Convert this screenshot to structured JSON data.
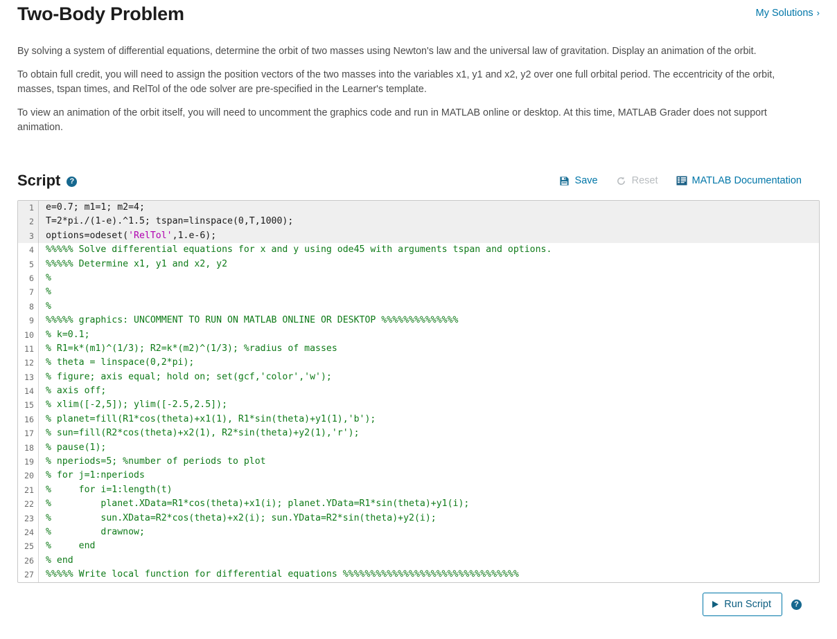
{
  "header": {
    "title": "Two-Body Problem",
    "my_solutions_label": "My Solutions",
    "my_solutions_chevron": "›"
  },
  "description": {
    "paragraphs": [
      "By solving a system of differential equations, determine the orbit of two masses using Newton's law and the universal law of gravitation.  Display an animation of the orbit.",
      "To obtain full credit, you will need to assign the position vectors of the two masses into the variables x1, y1 and x2, y2 over one full orbital period.  The eccentricity of the orbit, masses, tspan times, and RelTol of the ode solver are pre-specified in the Learner's template.",
      "To view an animation of the orbit itself, you will need to uncomment the graphics code and run  in MATLAB online or desktop.  At this time, MATLAB Grader does not support animation."
    ]
  },
  "script_section": {
    "title": "Script",
    "help_glyph": "?",
    "toolbar": {
      "save_label": "Save",
      "reset_label": "Reset",
      "docs_label": "MATLAB Documentation"
    }
  },
  "editor": {
    "lines": [
      {
        "n": "1",
        "readonly": true,
        "segments": [
          {
            "t": "e=0.7; m1=1; m2=4;",
            "c": "code"
          }
        ]
      },
      {
        "n": "2",
        "readonly": true,
        "segments": [
          {
            "t": "T=2*pi./(1-e).^1.5; tspan=linspace(0,T,1000);",
            "c": "code"
          }
        ]
      },
      {
        "n": "3",
        "readonly": true,
        "segments": [
          {
            "t": "options=odeset(",
            "c": "code"
          },
          {
            "t": "'RelTol'",
            "c": "st"
          },
          {
            "t": ",1.e-6);",
            "c": "code"
          }
        ]
      },
      {
        "n": "4",
        "readonly": false,
        "segments": [
          {
            "t": "%%%%% Solve differential equations for x and y using ode45 with arguments tspan and options.",
            "c": "cm"
          }
        ]
      },
      {
        "n": "5",
        "readonly": false,
        "segments": [
          {
            "t": "%%%%% Determine x1, y1 and x2, y2",
            "c": "cm"
          }
        ]
      },
      {
        "n": "6",
        "readonly": false,
        "segments": [
          {
            "t": "%",
            "c": "cm"
          }
        ]
      },
      {
        "n": "7",
        "readonly": false,
        "segments": [
          {
            "t": "%",
            "c": "cm"
          }
        ]
      },
      {
        "n": "8",
        "readonly": false,
        "segments": [
          {
            "t": "%",
            "c": "cm"
          }
        ]
      },
      {
        "n": "9",
        "readonly": false,
        "segments": [
          {
            "t": "%%%%% graphics: UNCOMMENT TO RUN ON MATLAB ONLINE OR DESKTOP %%%%%%%%%%%%%%",
            "c": "cm"
          }
        ]
      },
      {
        "n": "10",
        "readonly": false,
        "segments": [
          {
            "t": "% k=0.1;",
            "c": "cm"
          }
        ]
      },
      {
        "n": "11",
        "readonly": false,
        "segments": [
          {
            "t": "% R1=k*(m1)^(1/3); R2=k*(m2)^(1/3); %radius of masses",
            "c": "cm"
          }
        ]
      },
      {
        "n": "12",
        "readonly": false,
        "segments": [
          {
            "t": "% theta = linspace(0,2*pi);",
            "c": "cm"
          }
        ]
      },
      {
        "n": "13",
        "readonly": false,
        "segments": [
          {
            "t": "% figure; axis equal; hold on; set(gcf,'color','w');",
            "c": "cm"
          }
        ]
      },
      {
        "n": "14",
        "readonly": false,
        "segments": [
          {
            "t": "% axis off;",
            "c": "cm"
          }
        ]
      },
      {
        "n": "15",
        "readonly": false,
        "segments": [
          {
            "t": "% xlim([-2,5]); ylim([-2.5,2.5]);",
            "c": "cm"
          }
        ]
      },
      {
        "n": "16",
        "readonly": false,
        "segments": [
          {
            "t": "% planet=fill(R1*cos(theta)+x1(1), R1*sin(theta)+y1(1),'b');",
            "c": "cm"
          }
        ]
      },
      {
        "n": "17",
        "readonly": false,
        "segments": [
          {
            "t": "% sun=fill(R2*cos(theta)+x2(1), R2*sin(theta)+y2(1),'r');",
            "c": "cm"
          }
        ]
      },
      {
        "n": "18",
        "readonly": false,
        "segments": [
          {
            "t": "% pause(1);",
            "c": "cm"
          }
        ]
      },
      {
        "n": "19",
        "readonly": false,
        "segments": [
          {
            "t": "% nperiods=5; %number of periods to plot",
            "c": "cm"
          }
        ]
      },
      {
        "n": "20",
        "readonly": false,
        "segments": [
          {
            "t": "% for j=1:nperiods",
            "c": "cm"
          }
        ]
      },
      {
        "n": "21",
        "readonly": false,
        "segments": [
          {
            "t": "%     for i=1:length(t)",
            "c": "cm"
          }
        ]
      },
      {
        "n": "22",
        "readonly": false,
        "segments": [
          {
            "t": "%         planet.XData=R1*cos(theta)+x1(i); planet.YData=R1*sin(theta)+y1(i);",
            "c": "cm"
          }
        ]
      },
      {
        "n": "23",
        "readonly": false,
        "segments": [
          {
            "t": "%         sun.XData=R2*cos(theta)+x2(i); sun.YData=R2*sin(theta)+y2(i);",
            "c": "cm"
          }
        ]
      },
      {
        "n": "24",
        "readonly": false,
        "segments": [
          {
            "t": "%         drawnow;",
            "c": "cm"
          }
        ]
      },
      {
        "n": "25",
        "readonly": false,
        "segments": [
          {
            "t": "%     end",
            "c": "cm"
          }
        ]
      },
      {
        "n": "26",
        "readonly": false,
        "segments": [
          {
            "t": "% end",
            "c": "cm"
          }
        ]
      },
      {
        "n": "27",
        "readonly": false,
        "segments": [
          {
            "t": "%%%%% Write local function for differential equations %%%%%%%%%%%%%%%%%%%%%%%%%%%%%%%%",
            "c": "cm"
          }
        ]
      }
    ]
  },
  "run_bar": {
    "run_label": "Run Script",
    "help_glyph": "?"
  },
  "colors": {
    "link_teal": "#0076a8",
    "comment_green": "#0e7a18",
    "string_magenta": "#b000b0",
    "readonly_bg": "#efefef",
    "disabled_gray": "#b9bdc0"
  }
}
